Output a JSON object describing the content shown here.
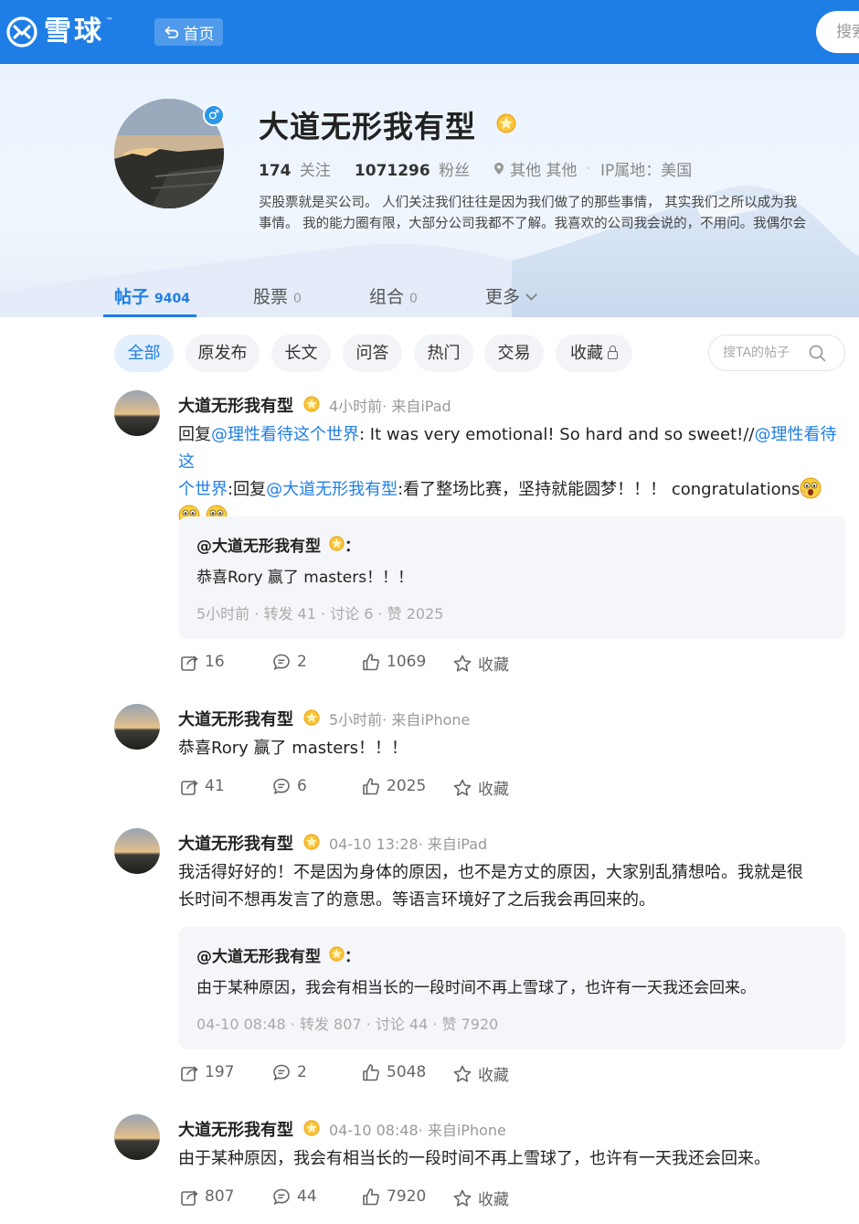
{
  "header": {
    "logo_text": "雪球",
    "logo_tm": "™",
    "home_label": "首页",
    "search_placeholder": "搜索"
  },
  "profile": {
    "name": "大道无形我有型",
    "gender_symbol": "♂",
    "following_count": "174",
    "following_label": "关注",
    "followers_count": "1071296",
    "followers_label": "粉丝",
    "location": "其他 其他",
    "ip_location": "IP属地：美国",
    "bio_line1": "买股票就是买公司。 人们关注我们往往是因为我们做了的那些事情， 其实我们之所以成为我",
    "bio_line2": "事情。 我的能力圈有限，大部分公司我都不了解。我喜欢的公司我会说的，不用问。我偶尔会"
  },
  "tabs": [
    {
      "label": "帖子",
      "count": "9404"
    },
    {
      "label": "股票",
      "count": "0"
    },
    {
      "label": "组合",
      "count": "0"
    },
    {
      "label": "更多",
      "count": ""
    }
  ],
  "filters": [
    "全部",
    "原发布",
    "长文",
    "问答",
    "热门",
    "交易",
    "收藏"
  ],
  "post_search_placeholder": "搜TA的帖子",
  "posts": [
    {
      "author": "大道无形我有型",
      "meta": "4小时前· 来自iPad",
      "text_parts": [
        "回复",
        "@理性看待这个世界",
        ": It was very emotional! So hard and so sweet!//",
        "@理性看待这",
        "个世界",
        ":回复",
        "@大道无形我有型",
        ":看了整场比赛，坚持就能圆梦！！！ congratulations"
      ],
      "quote": {
        "author": "@大道无形我有型",
        "colon": "：",
        "text": "恭喜Rory 赢了 masters！！！",
        "meta": "5小时前  · 转发 41 · 讨论 6 · 赞 2025"
      },
      "reposts": "16",
      "comments": "2",
      "likes": "1069",
      "fav": "收藏"
    },
    {
      "author": "大道无形我有型",
      "meta": "5小时前· 来自iPhone",
      "text": "恭喜Rory 赢了 masters！！！",
      "reposts": "41",
      "comments": "6",
      "likes": "2025",
      "fav": "收藏"
    },
    {
      "author": "大道无形我有型",
      "meta": "04-10 13:28· 来自iPad",
      "text_line1": "我活得好好的！不是因为身体的原因，也不是方丈的原因，大家别乱猜想哈。我就是很",
      "text_line2": "长时间不想再发言了的意思。等语言环境好了之后我会再回来的。",
      "quote": {
        "author": "@大道无形我有型",
        "colon": "：",
        "text": "由于某种原因，我会有相当长的一段时间不再上雪球了，也许有一天我还会回来。",
        "meta": "04-10 08:48  · 转发 807 · 讨论 44 · 赞 7920"
      },
      "reposts": "197",
      "comments": "2",
      "likes": "5048",
      "fav": "收藏"
    },
    {
      "author": "大道无形我有型",
      "meta": "04-10 08:48· 来自iPhone",
      "text": "由于某种原因，我会有相当长的一段时间不再上雪球了，也许有一天我还会回来。",
      "reposts": "807",
      "comments": "44",
      "likes": "7920",
      "fav": "收藏"
    }
  ],
  "colors": {
    "brand_blue": "#1f7ee6",
    "badge_gold": "#f5b31c",
    "chip_bg": "#f2f4f7",
    "quote_bg": "#f4f6f9"
  }
}
